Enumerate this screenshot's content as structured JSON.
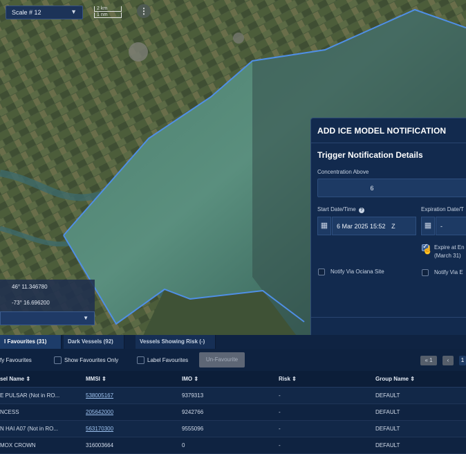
{
  "map": {
    "scale_label": "Scale # 12",
    "scale_bar_top": "2 km",
    "scale_bar_bottom": "1 nm",
    "info_icon": "vertical-dots-icon",
    "latitude": "46° 11.346780",
    "longitude": "-73° 16.696200",
    "select_value": ""
  },
  "dialog": {
    "title": "ADD ICE MODEL NOTIFICATION",
    "section_title": "Trigger Notification Details",
    "concentration_label": "Concentration Above",
    "concentration_value": "6",
    "start_label": "Start Date/Time",
    "start_value": "6 Mar 2025 15:52",
    "start_tz": "Z",
    "expiration_label": "Expiration Date/T",
    "expiration_value": "-",
    "expire_end_label": "Expire at En",
    "expire_end_sub": "(March 31)",
    "expire_end_checked": true,
    "notify_site_label": "Notify Via Ociana Site",
    "notify_site_checked": false,
    "notify_email_label": "Notify Via E",
    "notify_email_checked": false
  },
  "tabs": [
    {
      "label": "l Favourites (31)",
      "active": true
    },
    {
      "label": "Dark Vessels (92)",
      "active": false
    },
    {
      "label": "Vessels Showing Risk (-)",
      "active": false
    }
  ],
  "toolbar": {
    "notify_favourites": "fy Favourites",
    "show_favourites_only": "Show Favourites Only",
    "label_favourites": "Label Favourites",
    "unfavourite": "Un-Favourite",
    "pager_first": "« 1",
    "pager_prev": "‹",
    "pager_current": "1"
  },
  "table": {
    "columns": [
      "sel Name ⇕",
      "MMSI ⇕",
      "IMO ⇕",
      "Risk ⇕",
      "Group Name ⇕"
    ],
    "rows": [
      {
        "name": "E PULSAR (Not in RO...",
        "mmsi": "538005167",
        "mmsi_link": true,
        "imo": "9379313",
        "risk": "-",
        "group": "DEFAULT"
      },
      {
        "name": "NCESS",
        "mmsi": "205642000",
        "mmsi_link": true,
        "imo": "9242766",
        "risk": "-",
        "group": "DEFAULT"
      },
      {
        "name": "N HAI A07 (Not in RO...",
        "mmsi": "563170300",
        "mmsi_link": true,
        "imo": "9555096",
        "risk": "-",
        "group": "DEFAULT"
      },
      {
        "name": "MOX CROWN",
        "mmsi": "316003664",
        "mmsi_link": false,
        "imo": "0",
        "risk": "-",
        "group": "DEFAULT"
      }
    ]
  },
  "colors": {
    "panel_bg": "#122a4e",
    "boundary": "#4f8fe6",
    "table_bg": "#0f2341"
  }
}
